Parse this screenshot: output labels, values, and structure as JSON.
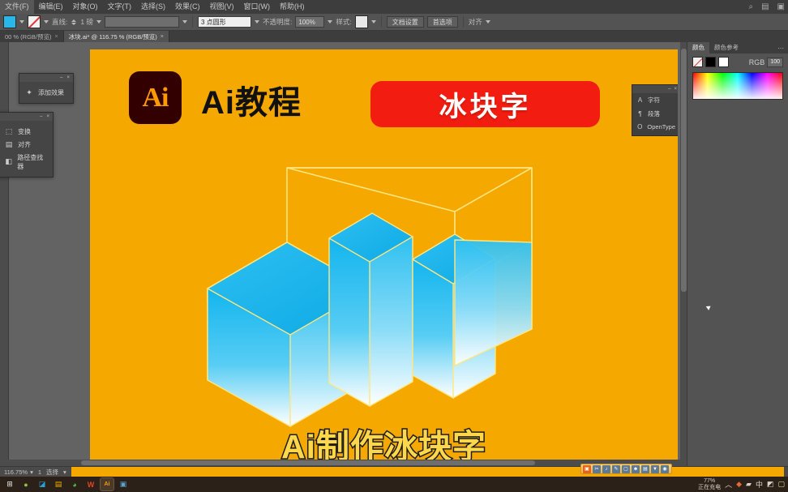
{
  "menubar": {
    "items": [
      {
        "label": "文件(F)"
      },
      {
        "label": "编辑(E)"
      },
      {
        "label": "对象(O)"
      },
      {
        "label": "文字(T)"
      },
      {
        "label": "选择(S)"
      },
      {
        "label": "效果(C)"
      },
      {
        "label": "视图(V)"
      },
      {
        "label": "窗口(W)"
      },
      {
        "label": "帮助(H)"
      }
    ],
    "window_controls": [
      {
        "icon": "search-icon",
        "glyph": "⌕"
      },
      {
        "icon": "arrange-documents-icon",
        "glyph": "▤"
      },
      {
        "icon": "workspace-switcher-icon",
        "glyph": "▣"
      }
    ]
  },
  "controlbar": {
    "fill_label": "填色",
    "fill_color": "#29b6e8",
    "stroke_label": "描边",
    "stroke_value": "无",
    "weight_label": "直线:",
    "weight_value": "1 磅",
    "brush_value": "",
    "shape_label": "3 点圆形",
    "opacity_label": "不透明度:",
    "opacity_value": "100%",
    "style_label": "样式:",
    "doc_setup_label": "文档设置",
    "preferences_label": "首选项",
    "align_label": "对齐"
  },
  "tabbar": {
    "tabs": [
      {
        "label": "00 % (RGB/预览)",
        "active": false,
        "close": "×"
      },
      {
        "label": "冰块.ai* @ 116.75 % (RGB/预览)",
        "active": true,
        "close": "×"
      }
    ]
  },
  "panels": {
    "floating_a": {
      "title": "",
      "items": [
        {
          "icon": "effects-icon",
          "glyph": "✦",
          "label": "添加效果"
        }
      ],
      "controls": [
        {
          "icon": "minimize-icon",
          "glyph": "–"
        },
        {
          "icon": "close-icon",
          "glyph": "×"
        }
      ]
    },
    "floating_b": {
      "items": [
        {
          "icon": "transform-icon",
          "glyph": "⬚",
          "label": "变换"
        },
        {
          "icon": "align-icon",
          "glyph": "▤",
          "label": "对齐"
        },
        {
          "icon": "pathfinder-icon",
          "glyph": "◧",
          "label": "路径查找器"
        }
      ],
      "controls": [
        {
          "icon": "minimize-icon",
          "glyph": "–"
        },
        {
          "icon": "close-icon",
          "glyph": "×"
        }
      ]
    },
    "character": {
      "items": [
        {
          "icon": "character-icon",
          "glyph": "A",
          "label": "字符"
        },
        {
          "icon": "paragraph-icon",
          "glyph": "¶",
          "label": "段落"
        },
        {
          "icon": "opentype-icon",
          "glyph": "O",
          "label": "OpenType"
        }
      ],
      "controls": [
        {
          "icon": "minimize-icon",
          "glyph": "–"
        },
        {
          "icon": "close-icon",
          "glyph": "×"
        }
      ]
    }
  },
  "dock": {
    "tabs": [
      {
        "label": "颜色",
        "active": true
      },
      {
        "label": "颜色参考",
        "active": false
      }
    ],
    "menu_glyph": "⋯",
    "color_swatches": [
      {
        "name": "none-swatch",
        "type": "none"
      },
      {
        "name": "black-swatch",
        "type": "black"
      },
      {
        "name": "white-swatch",
        "type": "white"
      }
    ],
    "color_mode": "RGB",
    "percent_chip": "100"
  },
  "artboard": {
    "background_color": "#f5a800",
    "logo": {
      "text": "Ai",
      "bg": "#330000",
      "fg": "#ff9a00"
    },
    "title": "Ai教程",
    "banner": {
      "text": "冰块字",
      "bg": "#f21d10",
      "fg": "#ffffff"
    },
    "subtitle": "Ai制作冰块字",
    "illustration": {
      "name": "isometric-ice-blocks",
      "outline_color": "#ffe680",
      "ice_top": "#1fb6ec",
      "ice_bottom": "#ffffff"
    }
  },
  "statusbar": {
    "zoom_value": "116.75%",
    "tool_label": "选择",
    "artboard_nav": "1",
    "page_label": ""
  },
  "video_toolbar": {
    "buttons": [
      {
        "name": "record-button",
        "glyph": "▣"
      },
      {
        "name": "screenshot-button",
        "glyph": "✂"
      },
      {
        "name": "audio-button",
        "glyph": "♪"
      },
      {
        "name": "draw-button",
        "glyph": "✎"
      },
      {
        "name": "webcam-button",
        "glyph": "▢"
      },
      {
        "name": "user-button",
        "glyph": "☻"
      },
      {
        "name": "notes-button",
        "glyph": "▤"
      },
      {
        "name": "filter-button",
        "glyph": "▼"
      },
      {
        "name": "settings-button",
        "glyph": "◉"
      }
    ]
  },
  "taskbar": {
    "apps": [
      {
        "name": "start-button",
        "glyph": "⊞",
        "color": "#e8e8e8",
        "bg": "transparent",
        "active": false
      },
      {
        "name": "app-green-icon",
        "glyph": "●",
        "color": "#8bc34a",
        "bg": "transparent",
        "active": false
      },
      {
        "name": "app-blue-icon",
        "glyph": "◪",
        "color": "#29a0d8",
        "bg": "transparent",
        "active": false
      },
      {
        "name": "file-explorer-icon",
        "glyph": "▤",
        "color": "#f0b000",
        "bg": "transparent",
        "active": false
      },
      {
        "name": "wechat-icon",
        "glyph": "◕",
        "color": "#4ec34e",
        "bg": "transparent",
        "active": false
      },
      {
        "name": "wps-icon",
        "glyph": "W",
        "color": "#e8422b",
        "bg": "transparent",
        "active": false
      },
      {
        "name": "illustrator-icon",
        "glyph": "Ai",
        "color": "#ff9a00",
        "bg": "#4a3a2a",
        "active": true
      },
      {
        "name": "media-icon",
        "glyph": "▣",
        "color": "#5ba3cf",
        "bg": "transparent",
        "active": false
      }
    ],
    "tray": {
      "battery_percent": "77%",
      "battery_label": "正在充电",
      "icons": [
        {
          "name": "chevron-up-icon",
          "glyph": "︿"
        },
        {
          "name": "security-icon",
          "glyph": "◆"
        },
        {
          "name": "network-icon",
          "glyph": "▰"
        },
        {
          "name": "ime-icon",
          "glyph": "中"
        },
        {
          "name": "volume-icon",
          "glyph": "◩"
        },
        {
          "name": "notification-icon",
          "glyph": "▢"
        }
      ]
    }
  }
}
